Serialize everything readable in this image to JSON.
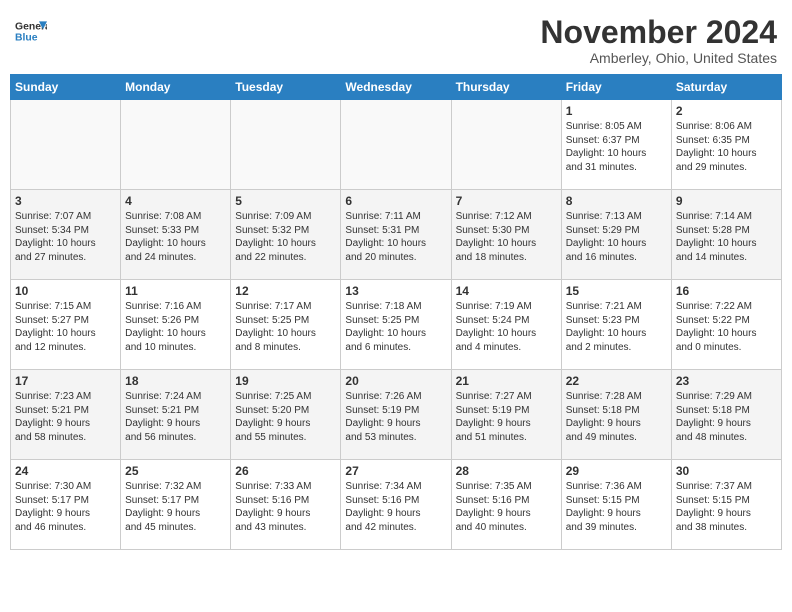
{
  "header": {
    "logo_line1": "General",
    "logo_line2": "Blue",
    "month": "November 2024",
    "location": "Amberley, Ohio, United States"
  },
  "weekdays": [
    "Sunday",
    "Monday",
    "Tuesday",
    "Wednesday",
    "Thursday",
    "Friday",
    "Saturday"
  ],
  "weeks": [
    [
      {
        "day": "",
        "info": ""
      },
      {
        "day": "",
        "info": ""
      },
      {
        "day": "",
        "info": ""
      },
      {
        "day": "",
        "info": ""
      },
      {
        "day": "",
        "info": ""
      },
      {
        "day": "1",
        "info": "Sunrise: 8:05 AM\nSunset: 6:37 PM\nDaylight: 10 hours\nand 31 minutes."
      },
      {
        "day": "2",
        "info": "Sunrise: 8:06 AM\nSunset: 6:35 PM\nDaylight: 10 hours\nand 29 minutes."
      }
    ],
    [
      {
        "day": "3",
        "info": "Sunrise: 7:07 AM\nSunset: 5:34 PM\nDaylight: 10 hours\nand 27 minutes."
      },
      {
        "day": "4",
        "info": "Sunrise: 7:08 AM\nSunset: 5:33 PM\nDaylight: 10 hours\nand 24 minutes."
      },
      {
        "day": "5",
        "info": "Sunrise: 7:09 AM\nSunset: 5:32 PM\nDaylight: 10 hours\nand 22 minutes."
      },
      {
        "day": "6",
        "info": "Sunrise: 7:11 AM\nSunset: 5:31 PM\nDaylight: 10 hours\nand 20 minutes."
      },
      {
        "day": "7",
        "info": "Sunrise: 7:12 AM\nSunset: 5:30 PM\nDaylight: 10 hours\nand 18 minutes."
      },
      {
        "day": "8",
        "info": "Sunrise: 7:13 AM\nSunset: 5:29 PM\nDaylight: 10 hours\nand 16 minutes."
      },
      {
        "day": "9",
        "info": "Sunrise: 7:14 AM\nSunset: 5:28 PM\nDaylight: 10 hours\nand 14 minutes."
      }
    ],
    [
      {
        "day": "10",
        "info": "Sunrise: 7:15 AM\nSunset: 5:27 PM\nDaylight: 10 hours\nand 12 minutes."
      },
      {
        "day": "11",
        "info": "Sunrise: 7:16 AM\nSunset: 5:26 PM\nDaylight: 10 hours\nand 10 minutes."
      },
      {
        "day": "12",
        "info": "Sunrise: 7:17 AM\nSunset: 5:25 PM\nDaylight: 10 hours\nand 8 minutes."
      },
      {
        "day": "13",
        "info": "Sunrise: 7:18 AM\nSunset: 5:25 PM\nDaylight: 10 hours\nand 6 minutes."
      },
      {
        "day": "14",
        "info": "Sunrise: 7:19 AM\nSunset: 5:24 PM\nDaylight: 10 hours\nand 4 minutes."
      },
      {
        "day": "15",
        "info": "Sunrise: 7:21 AM\nSunset: 5:23 PM\nDaylight: 10 hours\nand 2 minutes."
      },
      {
        "day": "16",
        "info": "Sunrise: 7:22 AM\nSunset: 5:22 PM\nDaylight: 10 hours\nand 0 minutes."
      }
    ],
    [
      {
        "day": "17",
        "info": "Sunrise: 7:23 AM\nSunset: 5:21 PM\nDaylight: 9 hours\nand 58 minutes."
      },
      {
        "day": "18",
        "info": "Sunrise: 7:24 AM\nSunset: 5:21 PM\nDaylight: 9 hours\nand 56 minutes."
      },
      {
        "day": "19",
        "info": "Sunrise: 7:25 AM\nSunset: 5:20 PM\nDaylight: 9 hours\nand 55 minutes."
      },
      {
        "day": "20",
        "info": "Sunrise: 7:26 AM\nSunset: 5:19 PM\nDaylight: 9 hours\nand 53 minutes."
      },
      {
        "day": "21",
        "info": "Sunrise: 7:27 AM\nSunset: 5:19 PM\nDaylight: 9 hours\nand 51 minutes."
      },
      {
        "day": "22",
        "info": "Sunrise: 7:28 AM\nSunset: 5:18 PM\nDaylight: 9 hours\nand 49 minutes."
      },
      {
        "day": "23",
        "info": "Sunrise: 7:29 AM\nSunset: 5:18 PM\nDaylight: 9 hours\nand 48 minutes."
      }
    ],
    [
      {
        "day": "24",
        "info": "Sunrise: 7:30 AM\nSunset: 5:17 PM\nDaylight: 9 hours\nand 46 minutes."
      },
      {
        "day": "25",
        "info": "Sunrise: 7:32 AM\nSunset: 5:17 PM\nDaylight: 9 hours\nand 45 minutes."
      },
      {
        "day": "26",
        "info": "Sunrise: 7:33 AM\nSunset: 5:16 PM\nDaylight: 9 hours\nand 43 minutes."
      },
      {
        "day": "27",
        "info": "Sunrise: 7:34 AM\nSunset: 5:16 PM\nDaylight: 9 hours\nand 42 minutes."
      },
      {
        "day": "28",
        "info": "Sunrise: 7:35 AM\nSunset: 5:16 PM\nDaylight: 9 hours\nand 40 minutes."
      },
      {
        "day": "29",
        "info": "Sunrise: 7:36 AM\nSunset: 5:15 PM\nDaylight: 9 hours\nand 39 minutes."
      },
      {
        "day": "30",
        "info": "Sunrise: 7:37 AM\nSunset: 5:15 PM\nDaylight: 9 hours\nand 38 minutes."
      }
    ]
  ]
}
